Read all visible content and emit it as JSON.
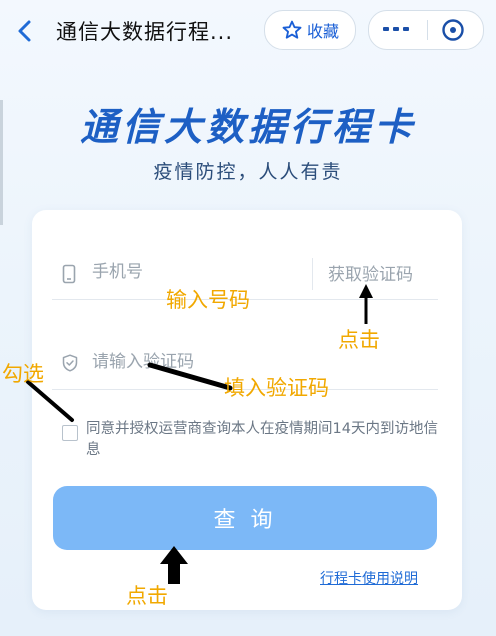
{
  "nav": {
    "title": "通信大数据行程...",
    "favorite_label": "收藏",
    "back_icon": "chevron-left-icon",
    "favorite_icon": "star-icon",
    "more_icon": "more-dots-icon",
    "close_icon": "miniapp-close-icon"
  },
  "hero": {
    "title": "通信大数据行程卡",
    "subtitle": "疫情防控，人人有责"
  },
  "form": {
    "phone_placeholder": "手机号",
    "get_code_label": "获取验证码",
    "code_placeholder": "请输入验证码",
    "agreement_text": "同意并授权运营商查询本人在疫情期间14天内到访地信息",
    "agreement_checked": false,
    "query_button_label": "查 询",
    "help_link_label": "行程卡使用说明"
  },
  "annotations": {
    "enter_number": "输入号码",
    "tap_get_code": "点击",
    "check_box": "勾选",
    "enter_code": "填入验证码",
    "tap_query": "点击"
  },
  "colors": {
    "accent": "#1d5fc4",
    "button": "#7cb8f7",
    "annotation": "#f1a800",
    "link": "#1f6bd6"
  }
}
